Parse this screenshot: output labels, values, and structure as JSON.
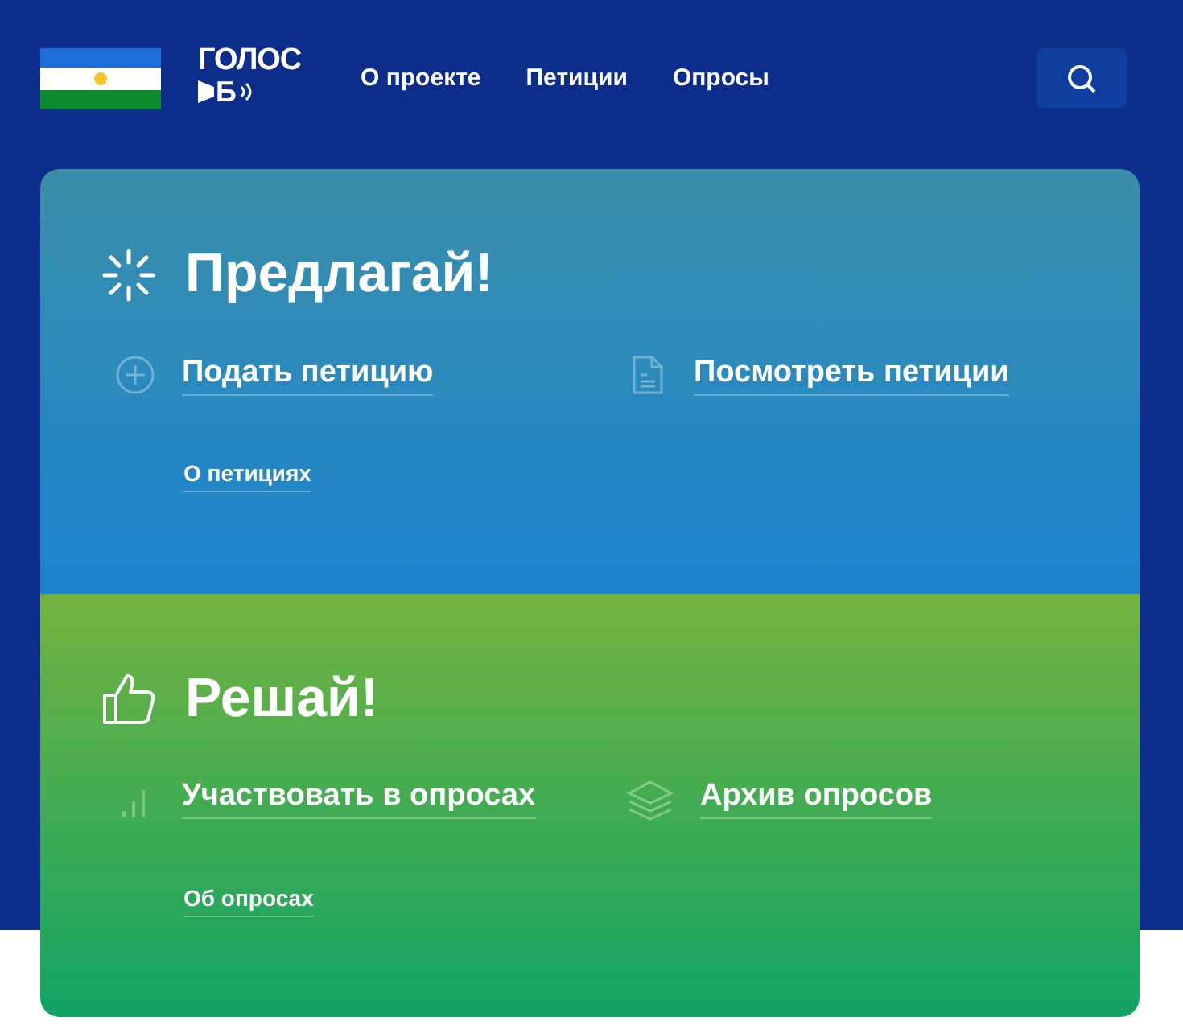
{
  "header": {
    "logo": {
      "line_1": "ГОЛОС",
      "line_2": "Б"
    },
    "nav": [
      "О проекте",
      "Петиции",
      "Опросы"
    ]
  },
  "sections": [
    {
      "title": "Предлагай!",
      "links": [
        "Подать петицию",
        "Посмотреть петиции"
      ],
      "about": "О петициях"
    },
    {
      "title": "Решай!",
      "links": [
        "Участвовать в опросах",
        "Архив опросов"
      ],
      "about": "Об опросах"
    }
  ]
}
